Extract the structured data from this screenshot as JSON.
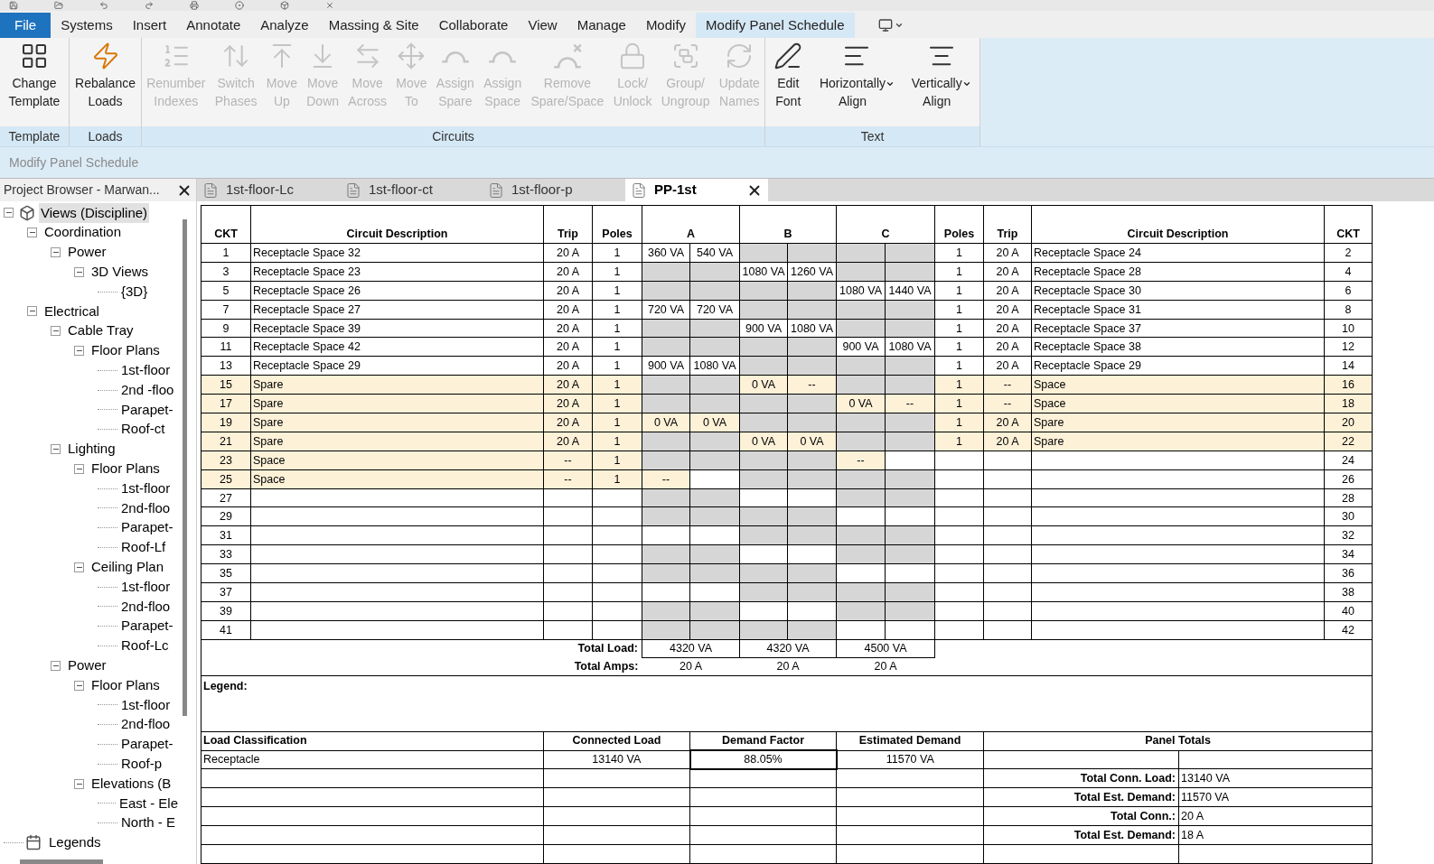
{
  "menu_tabs": [
    {
      "label": "File",
      "kind": "file",
      "selected": false
    },
    {
      "label": "Systems",
      "kind": "tab",
      "selected": false
    },
    {
      "label": "Insert",
      "kind": "tab",
      "selected": false
    },
    {
      "label": "Annotate",
      "kind": "tab",
      "selected": false
    },
    {
      "label": "Analyze",
      "kind": "tab",
      "selected": false
    },
    {
      "label": "Massing & Site",
      "kind": "tab",
      "selected": false
    },
    {
      "label": "Collaborate",
      "kind": "tab",
      "selected": false
    },
    {
      "label": "View",
      "kind": "tab",
      "selected": false
    },
    {
      "label": "Manage",
      "kind": "tab",
      "selected": false
    },
    {
      "label": "Modify",
      "kind": "tab",
      "selected": false
    },
    {
      "label": "Modify Panel Schedule",
      "kind": "tab",
      "selected": true
    }
  ],
  "ribbon": {
    "panels": [
      {
        "title": "Template",
        "buttons": [
          {
            "lines": [
              "Change",
              "Template"
            ],
            "disabled": false
          }
        ]
      },
      {
        "title": "Loads",
        "buttons": [
          {
            "lines": [
              "Rebalance",
              "Loads"
            ],
            "disabled": false
          }
        ]
      },
      {
        "title": "Circuits",
        "buttons": [
          {
            "lines": [
              "Renumber",
              "Indexes"
            ],
            "disabled": true
          },
          {
            "lines": [
              "Switch",
              "Phases"
            ],
            "disabled": true
          },
          {
            "lines": [
              "Move",
              "Up"
            ],
            "disabled": true
          },
          {
            "lines": [
              "Move",
              "Down"
            ],
            "disabled": true
          },
          {
            "lines": [
              "Move",
              "Across"
            ],
            "disabled": true
          },
          {
            "lines": [
              "Move",
              "To"
            ],
            "disabled": true
          },
          {
            "lines": [
              "Assign",
              "Spare"
            ],
            "disabled": true
          },
          {
            "lines": [
              "Assign",
              "Space"
            ],
            "disabled": true
          },
          {
            "lines": [
              "Remove",
              "Spare/Space"
            ],
            "disabled": true
          },
          {
            "lines": [
              "Lock/",
              "Unlock"
            ],
            "disabled": true
          },
          {
            "lines": [
              "Group/",
              "Ungroup"
            ],
            "disabled": true
          },
          {
            "lines": [
              "Update",
              "Names"
            ],
            "disabled": true
          }
        ]
      },
      {
        "title": "Text",
        "buttons": [
          {
            "lines": [
              "Edit",
              "Font"
            ],
            "disabled": false
          },
          {
            "lines": [
              "Horizontally",
              "Align"
            ],
            "disabled": false,
            "has_menu": true
          },
          {
            "lines": [
              "Vertically",
              "Align"
            ],
            "disabled": false,
            "has_menu": true
          }
        ]
      }
    ],
    "context_label": "Modify Panel Schedule"
  },
  "project_browser": {
    "title": "Project Browser - Marwan...",
    "tree": [
      {
        "label": "Views (Discipline)",
        "selected": true,
        "expanded": true,
        "children": [
          {
            "label": "Coordination",
            "expanded": true,
            "children": [
              {
                "label": "Power",
                "expanded": true,
                "children": [
                  {
                    "label": "3D Views",
                    "expanded": true,
                    "children": [
                      {
                        "label": "{3D}"
                      }
                    ]
                  }
                ]
              }
            ]
          },
          {
            "label": "Electrical",
            "expanded": true,
            "children": [
              {
                "label": "Cable Tray",
                "expanded": true,
                "children": [
                  {
                    "label": "Floor Plans",
                    "expanded": true,
                    "children": [
                      {
                        "label": "1st-floor"
                      },
                      {
                        "label": "2nd -floo"
                      },
                      {
                        "label": "Parapet-"
                      },
                      {
                        "label": "Roof-ct"
                      }
                    ]
                  }
                ]
              },
              {
                "label": "Lighting",
                "expanded": true,
                "children": [
                  {
                    "label": "Floor Plans",
                    "expanded": true,
                    "children": [
                      {
                        "label": "1st-floor"
                      },
                      {
                        "label": "2nd-floo"
                      },
                      {
                        "label": "Parapet-"
                      },
                      {
                        "label": "Roof-Lf"
                      }
                    ]
                  },
                  {
                    "label": "Ceiling Plan",
                    "expanded": true,
                    "children": [
                      {
                        "label": "1st-floor"
                      },
                      {
                        "label": "2nd-floo"
                      },
                      {
                        "label": "Parapet-"
                      },
                      {
                        "label": "Roof-Lc"
                      }
                    ]
                  }
                ]
              },
              {
                "label": "Power",
                "expanded": true,
                "children": [
                  {
                    "label": "Floor Plans",
                    "expanded": true,
                    "children": [
                      {
                        "label": "1st-floor"
                      },
                      {
                        "label": "2nd-floo"
                      },
                      {
                        "label": "Parapet-"
                      },
                      {
                        "label": "Roof-p"
                      }
                    ]
                  },
                  {
                    "label": "Elevations (B",
                    "expanded": true,
                    "children": [
                      {
                        "label": "East - Ele"
                      },
                      {
                        "label": "North - E"
                      }
                    ]
                  }
                ]
              }
            ]
          }
        ]
      },
      {
        "label": "Legends"
      }
    ]
  },
  "doc_tabs": [
    {
      "label": "1st-floor-Lc",
      "selected": false
    },
    {
      "label": "1st-floor-ct",
      "selected": false
    },
    {
      "label": "1st-floor-p",
      "selected": false
    },
    {
      "label": "PP-1st",
      "selected": true
    }
  ],
  "schedule": {
    "columns": [
      "CKT",
      "Circuit Description",
      "Trip",
      "Poles",
      "A",
      "B",
      "C",
      "Poles",
      "Trip",
      "Circuit Description",
      "CKT"
    ],
    "rows": [
      {
        "left": {
          "ckt": "1",
          "desc": "Receptacle Space 32",
          "trip": "20 A",
          "poles": "1",
          "load": "360 VA",
          "highlighted": false
        },
        "right": {
          "ckt": "2",
          "desc": "Receptacle Space 24",
          "trip": "20 A",
          "poles": "1",
          "load": "540 VA",
          "highlighted": false
        }
      },
      {
        "left": {
          "ckt": "3",
          "desc": "Receptacle Space 23",
          "trip": "20 A",
          "poles": "1",
          "load": "1080 VA",
          "highlighted": false
        },
        "right": {
          "ckt": "4",
          "desc": "Receptacle Space 28",
          "trip": "20 A",
          "poles": "1",
          "load": "1260 VA",
          "highlighted": false
        }
      },
      {
        "left": {
          "ckt": "5",
          "desc": "Receptacle Space 26",
          "trip": "20 A",
          "poles": "1",
          "load": "1080 VA",
          "highlighted": false
        },
        "right": {
          "ckt": "6",
          "desc": "Receptacle Space 30",
          "trip": "20 A",
          "poles": "1",
          "load": "1440 VA",
          "highlighted": false
        }
      },
      {
        "left": {
          "ckt": "7",
          "desc": "Receptacle Space 27",
          "trip": "20 A",
          "poles": "1",
          "load": "720 VA",
          "highlighted": false
        },
        "right": {
          "ckt": "8",
          "desc": "Receptacle Space 31",
          "trip": "20 A",
          "poles": "1",
          "load": "720 VA",
          "highlighted": false
        }
      },
      {
        "left": {
          "ckt": "9",
          "desc": "Receptacle Space 39",
          "trip": "20 A",
          "poles": "1",
          "load": "900 VA",
          "highlighted": false
        },
        "right": {
          "ckt": "10",
          "desc": "Receptacle Space 37",
          "trip": "20 A",
          "poles": "1",
          "load": "1080 VA",
          "highlighted": false
        }
      },
      {
        "left": {
          "ckt": "11",
          "desc": "Receptacle Space 42",
          "trip": "20 A",
          "poles": "1",
          "load": "900 VA",
          "highlighted": false
        },
        "right": {
          "ckt": "12",
          "desc": "Receptacle Space 38",
          "trip": "20 A",
          "poles": "1",
          "load": "1080 VA",
          "highlighted": false
        }
      },
      {
        "left": {
          "ckt": "13",
          "desc": "Receptacle Space 29",
          "trip": "20 A",
          "poles": "1",
          "load": "900 VA",
          "highlighted": false
        },
        "right": {
          "ckt": "14",
          "desc": "Receptacle Space 29",
          "trip": "20 A",
          "poles": "1",
          "load": "1080 VA",
          "highlighted": false
        }
      },
      {
        "left": {
          "ckt": "15",
          "desc": "Spare",
          "trip": "20 A",
          "poles": "1",
          "load": "0 VA",
          "highlighted": true
        },
        "right": {
          "ckt": "16",
          "desc": "Space",
          "trip": "--",
          "poles": "1",
          "load": "--",
          "highlighted": true
        }
      },
      {
        "left": {
          "ckt": "17",
          "desc": "Spare",
          "trip": "20 A",
          "poles": "1",
          "load": "0 VA",
          "highlighted": true
        },
        "right": {
          "ckt": "18",
          "desc": "Space",
          "trip": "--",
          "poles": "1",
          "load": "--",
          "highlighted": true
        }
      },
      {
        "left": {
          "ckt": "19",
          "desc": "Spare",
          "trip": "20 A",
          "poles": "1",
          "load": "0 VA",
          "highlighted": true
        },
        "right": {
          "ckt": "20",
          "desc": "Spare",
          "trip": "20 A",
          "poles": "1",
          "load": "0 VA",
          "highlighted": true
        }
      },
      {
        "left": {
          "ckt": "21",
          "desc": "Spare",
          "trip": "20 A",
          "poles": "1",
          "load": "0 VA",
          "highlighted": true
        },
        "right": {
          "ckt": "22",
          "desc": "Spare",
          "trip": "20 A",
          "poles": "1",
          "load": "0 VA",
          "highlighted": true
        }
      },
      {
        "left": {
          "ckt": "23",
          "desc": "Space",
          "trip": "--",
          "poles": "1",
          "load": "--",
          "highlighted": true
        },
        "right": {
          "ckt": "24",
          "highlighted": false
        }
      },
      {
        "left": {
          "ckt": "25",
          "desc": "Space",
          "trip": "--",
          "poles": "1",
          "load": "--",
          "highlighted": true
        },
        "right": {
          "ckt": "26",
          "highlighted": false
        }
      },
      {
        "left": {
          "ckt": "27",
          "highlighted": false
        },
        "right": {
          "ckt": "28",
          "highlighted": false
        }
      },
      {
        "left": {
          "ckt": "29",
          "highlighted": false
        },
        "right": {
          "ckt": "30",
          "highlighted": false
        }
      },
      {
        "left": {
          "ckt": "31",
          "highlighted": false
        },
        "right": {
          "ckt": "32",
          "highlighted": false
        }
      },
      {
        "left": {
          "ckt": "33",
          "highlighted": false
        },
        "right": {
          "ckt": "34",
          "highlighted": false
        }
      },
      {
        "left": {
          "ckt": "35",
          "highlighted": false
        },
        "right": {
          "ckt": "36",
          "highlighted": false
        }
      },
      {
        "left": {
          "ckt": "37",
          "highlighted": false
        },
        "right": {
          "ckt": "38",
          "highlighted": false
        }
      },
      {
        "left": {
          "ckt": "39",
          "highlighted": false
        },
        "right": {
          "ckt": "40",
          "highlighted": false
        }
      },
      {
        "left": {
          "ckt": "41",
          "highlighted": false
        },
        "right": {
          "ckt": "42",
          "highlighted": false
        }
      }
    ],
    "totals": [
      {
        "label": "Total Load:",
        "values": [
          "4320 VA",
          "4320 VA",
          "4500 VA"
        ],
        "boxed": true
      },
      {
        "label": "Total Amps:",
        "values": [
          "20 A",
          "20 A",
          "20 A"
        ],
        "boxed": false
      }
    ],
    "legend_label": "Legend:",
    "load_table": {
      "columns": [
        "Load Classification",
        "Connected Load",
        "Demand Factor",
        "Estimated Demand",
        "Panel Totals"
      ],
      "rows": [
        {
          "classification": "Receptacle",
          "connected": "13140 VA",
          "demand_factor": "88.05%",
          "demand_factor_selected": true,
          "estimated": "11570 VA"
        }
      ],
      "panel_totals": [
        {
          "label": "Total Conn. Load:",
          "value": "13140 VA"
        },
        {
          "label": "Total Est. Demand:",
          "value": "11570 VA"
        },
        {
          "label": "Total Conn.:",
          "value": "20 A"
        },
        {
          "label": "Total Est. Demand:",
          "value": "18 A"
        }
      ]
    }
  }
}
